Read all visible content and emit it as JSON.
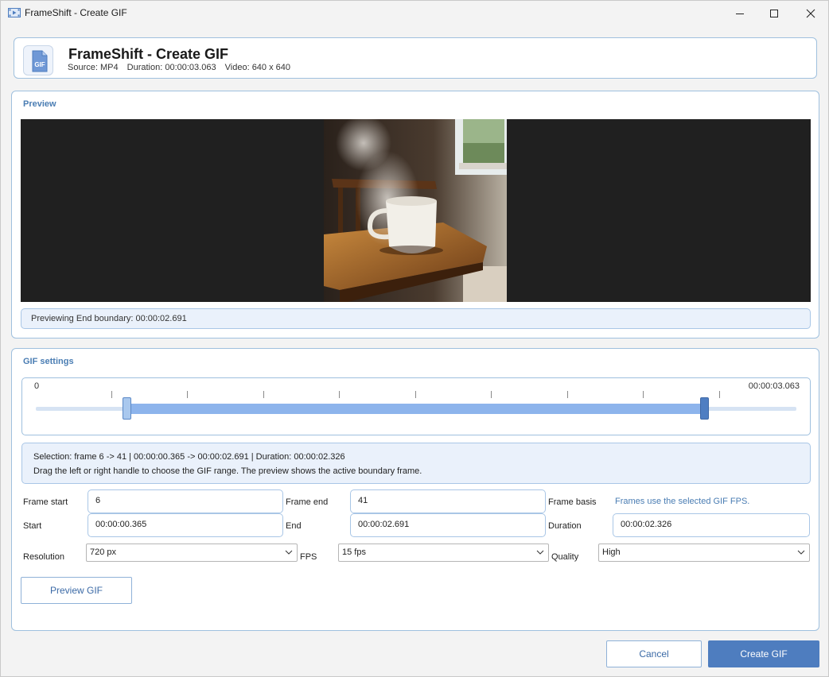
{
  "window": {
    "title": "FrameShift - Create GIF",
    "icon": "film-icon",
    "controls": [
      "minimize-icon",
      "maximize-icon",
      "close-icon"
    ]
  },
  "header": {
    "title": "FrameShift - Create GIF",
    "icon": "gif-file-icon",
    "icon_text": "GIF",
    "source": "Source: MP4",
    "duration": "Duration: 00:00:03.063",
    "video": "Video: 640 x 640"
  },
  "preview": {
    "group_title": "Preview",
    "status": "Previewing End boundary: 00:00:02.691"
  },
  "settings": {
    "group_title": "GIF settings",
    "timeline": {
      "start_label": "0",
      "end_label": "00:00:03.063",
      "range_start_fraction": 0.119,
      "range_end_fraction": 0.879
    },
    "selection_line": "Selection: frame 6 -> 41  |  00:00:00.365 -> 00:00:02.691  |  Duration: 00:00:02.326",
    "help_line": "Drag the left or right handle to choose the GIF range. The preview shows the active boundary frame.",
    "frame_start_label": "Frame start",
    "frame_start_value": "6",
    "frame_end_label": "Frame end",
    "frame_end_value": "41",
    "frame_basis_label": "Frame basis",
    "frame_basis_hint": "Frames use the selected GIF FPS.",
    "start_label": "Start",
    "start_value": "00:00:00.365",
    "end_label": "End",
    "end_value": "00:00:02.691",
    "duration_label": "Duration",
    "duration_value": "00:00:02.326",
    "resolution_label": "Resolution",
    "resolution_value": "720 px",
    "fps_label": "FPS",
    "fps_value": "15 fps",
    "quality_label": "Quality",
    "quality_value": "High",
    "preview_button": "Preview GIF"
  },
  "footer": {
    "cancel_button": "Cancel",
    "create_button": "Create GIF"
  },
  "colors": {
    "accent": "#4e7dbf",
    "border": "#9fc0de",
    "range": "#8db4ec"
  }
}
